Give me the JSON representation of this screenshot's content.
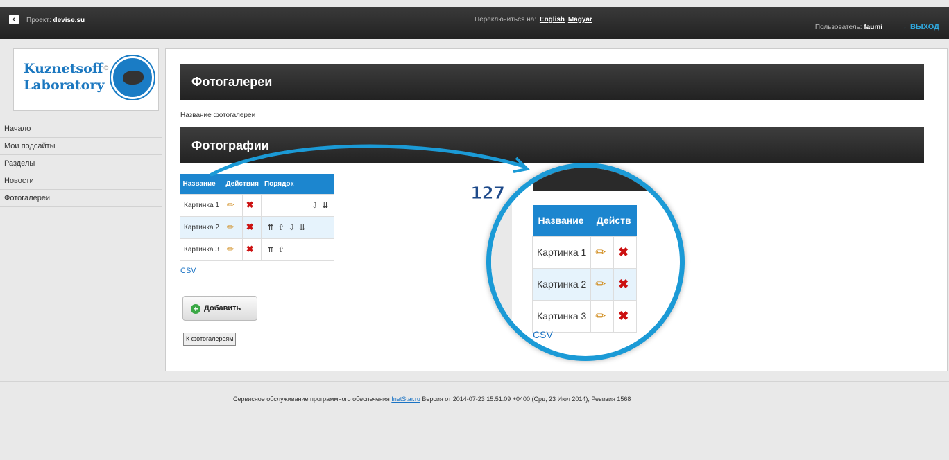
{
  "topbar": {
    "back_icon": "chevron-left-icon",
    "project_label": "Проект:",
    "project_name": "devise.su",
    "switch_label": "Переключиться на:",
    "languages": [
      "English",
      "Magyar"
    ],
    "user_label": "Пользователь:",
    "user_name": "faumi",
    "logout_label": "ВЫХОД",
    "logout_icon": "arrow-right-icon"
  },
  "logo": {
    "line1": "Kuznetsoff",
    "line2": "Laboratory",
    "mark": "©"
  },
  "nav": {
    "items": [
      "Начало",
      "Мои подсайты",
      "Разделы",
      "Новости",
      "Фотогалереи"
    ]
  },
  "main": {
    "title": "Фотогалереи",
    "gallery_name_label": "Название фотогалереи",
    "photos_title": "Фотографии",
    "table": {
      "headers": [
        "Название",
        "Действия",
        "Порядок"
      ],
      "rows": [
        {
          "name": "Картинка 1"
        },
        {
          "name": "Картинка 2"
        },
        {
          "name": "Картинка 3"
        }
      ]
    },
    "csv_link": "CSV",
    "add_button": "Добавить",
    "back_button": "К фотогалереям"
  },
  "zoom": {
    "level": "127",
    "headers": [
      "Название",
      "Действ"
    ],
    "rows": [
      "Картинка 1",
      "Картинка 2",
      "Картинка 3"
    ],
    "csv": "CSV"
  },
  "footer": {
    "text_before": "Сервисное обслуживание программного обеспечения",
    "link": "InetStar.ru",
    "text_after": "Версия от 2014-07-23 15:51:09 +0400 (Срд, 23 Июл 2014), Ревизия 1568"
  },
  "colors": {
    "accent": "#1c86cf",
    "delete": "#cc1111",
    "edit": "#d08a19",
    "add": "#3aa845"
  }
}
